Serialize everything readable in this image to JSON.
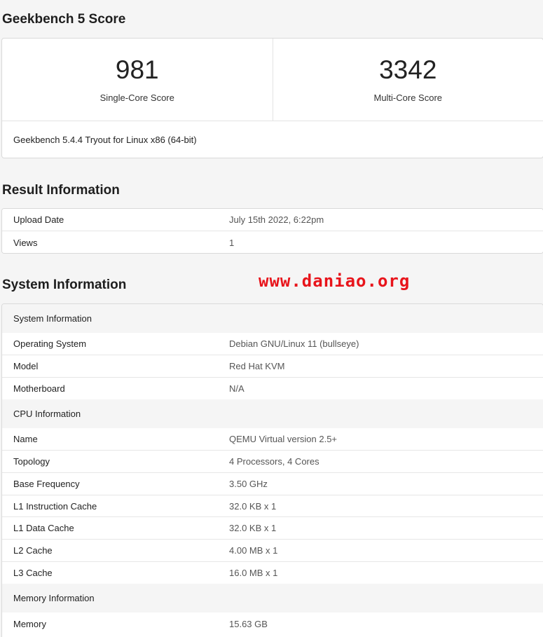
{
  "score": {
    "title": "Geekbench 5 Score",
    "single_value": "981",
    "single_label": "Single-Core Score",
    "multi_value": "3342",
    "multi_label": "Multi-Core Score",
    "footer": "Geekbench 5.4.4 Tryout for Linux x86 (64-bit)"
  },
  "result": {
    "title": "Result Information",
    "rows": [
      {
        "key": "Upload Date",
        "value": "July 15th 2022, 6:22pm"
      },
      {
        "key": "Views",
        "value": "1"
      }
    ]
  },
  "system": {
    "title": "System Information",
    "groups": [
      {
        "header": "System Information",
        "rows": [
          {
            "key": "Operating System",
            "value": "Debian GNU/Linux 11 (bullseye)"
          },
          {
            "key": "Model",
            "value": "Red Hat KVM"
          },
          {
            "key": "Motherboard",
            "value": "N/A"
          }
        ]
      },
      {
        "header": "CPU Information",
        "rows": [
          {
            "key": "Name",
            "value": "QEMU Virtual version 2.5+"
          },
          {
            "key": "Topology",
            "value": "4 Processors, 4 Cores"
          },
          {
            "key": "Base Frequency",
            "value": "3.50 GHz"
          },
          {
            "key": "L1 Instruction Cache",
            "value": "32.0 KB x 1"
          },
          {
            "key": "L1 Data Cache",
            "value": "32.0 KB x 1"
          },
          {
            "key": "L2 Cache",
            "value": "4.00 MB x 1"
          },
          {
            "key": "L3 Cache",
            "value": "16.0 MB x 1"
          }
        ]
      },
      {
        "header": "Memory Information",
        "rows": [
          {
            "key": "Memory",
            "value": "15.63 GB"
          }
        ]
      }
    ]
  },
  "watermark": "www.daniao.org"
}
